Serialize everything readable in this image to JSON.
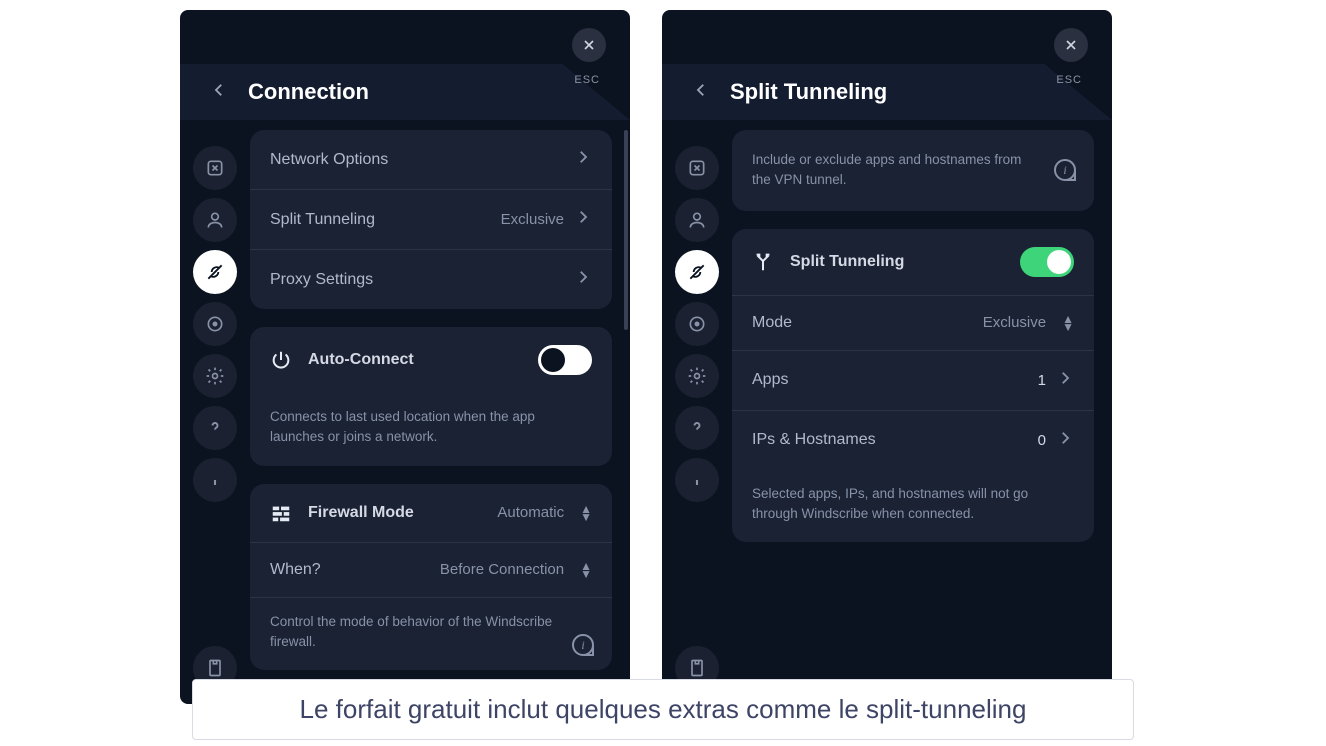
{
  "caption": "Le forfait gratuit inclut quelques extras comme le split-tunneling",
  "left": {
    "title": "Connection",
    "esc": "ESC",
    "nav": {
      "network_options": "Network Options",
      "split_tunneling": {
        "label": "Split Tunneling",
        "value": "Exclusive"
      },
      "proxy_settings": "Proxy Settings"
    },
    "auto_connect": {
      "label": "Auto-Connect",
      "enabled": true,
      "desc": "Connects to last used location when the app launches or joins a network."
    },
    "firewall": {
      "label": "Firewall Mode",
      "mode": "Automatic",
      "when_label": "When?",
      "when_value": "Before Connection",
      "desc": "Control the mode of behavior of the Windscribe firewall."
    }
  },
  "right": {
    "title": "Split Tunneling",
    "esc": "ESC",
    "intro": "Include or exclude apps and hostnames from the VPN tunnel.",
    "toggle": {
      "label": "Split Tunneling",
      "enabled": true
    },
    "mode": {
      "label": "Mode",
      "value": "Exclusive"
    },
    "apps": {
      "label": "Apps",
      "count": "1"
    },
    "ips": {
      "label": "IPs & Hostnames",
      "count": "0"
    },
    "footnote": "Selected apps, IPs, and hostnames will not go through Windscribe when connected."
  }
}
